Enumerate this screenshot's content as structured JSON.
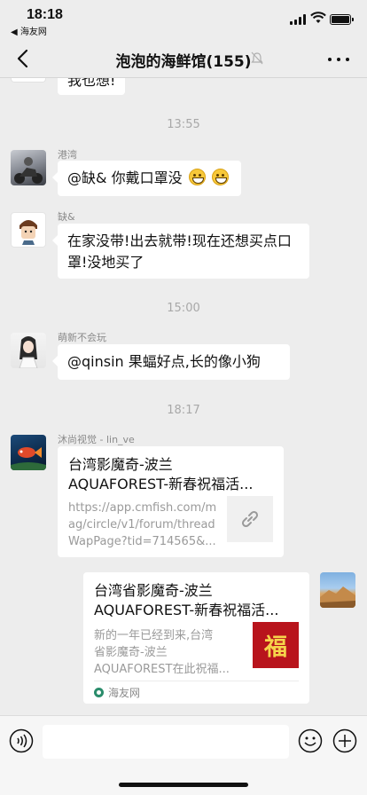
{
  "status": {
    "time": "18:18",
    "back_app": "◀ 海友网"
  },
  "nav": {
    "title": "泡泡的海鲜馆(155)"
  },
  "messages": {
    "partial_text": "我也想!",
    "ts1": "13:55",
    "m1": {
      "sender": "港湾",
      "text": "@缺& 你戴口罩没"
    },
    "m2": {
      "sender": "缺&",
      "text": "在家没带!出去就带!现在还想买点口罩!没地买了"
    },
    "ts2": "15:00",
    "m3": {
      "sender": "萌新不会玩",
      "text": "@qinsin 果蝠好点,长的像小狗"
    },
    "ts3": "18:17",
    "m4": {
      "sender": "沐尚视觉 - lin_ve",
      "title": "台湾影魔奇-波兰\nAQUAFOREST-新春祝福活...",
      "desc": "https://app.cmfish.com/m\nag/circle/v1/forum/thread\nWapPage?tid=714565&..."
    },
    "m5": {
      "title": "台湾省影魔奇-波兰\nAQUAFOREST-新春祝福活...",
      "desc": "新的一年已经到来,台湾\n省影魔奇-波兰\nAQUAFOREST在此祝福...",
      "thumb_text": "福",
      "source": "海友网"
    }
  },
  "colors": {
    "bg": "#ededed",
    "bubble": "#ffffff",
    "timestamp": "#a8a8a8"
  }
}
